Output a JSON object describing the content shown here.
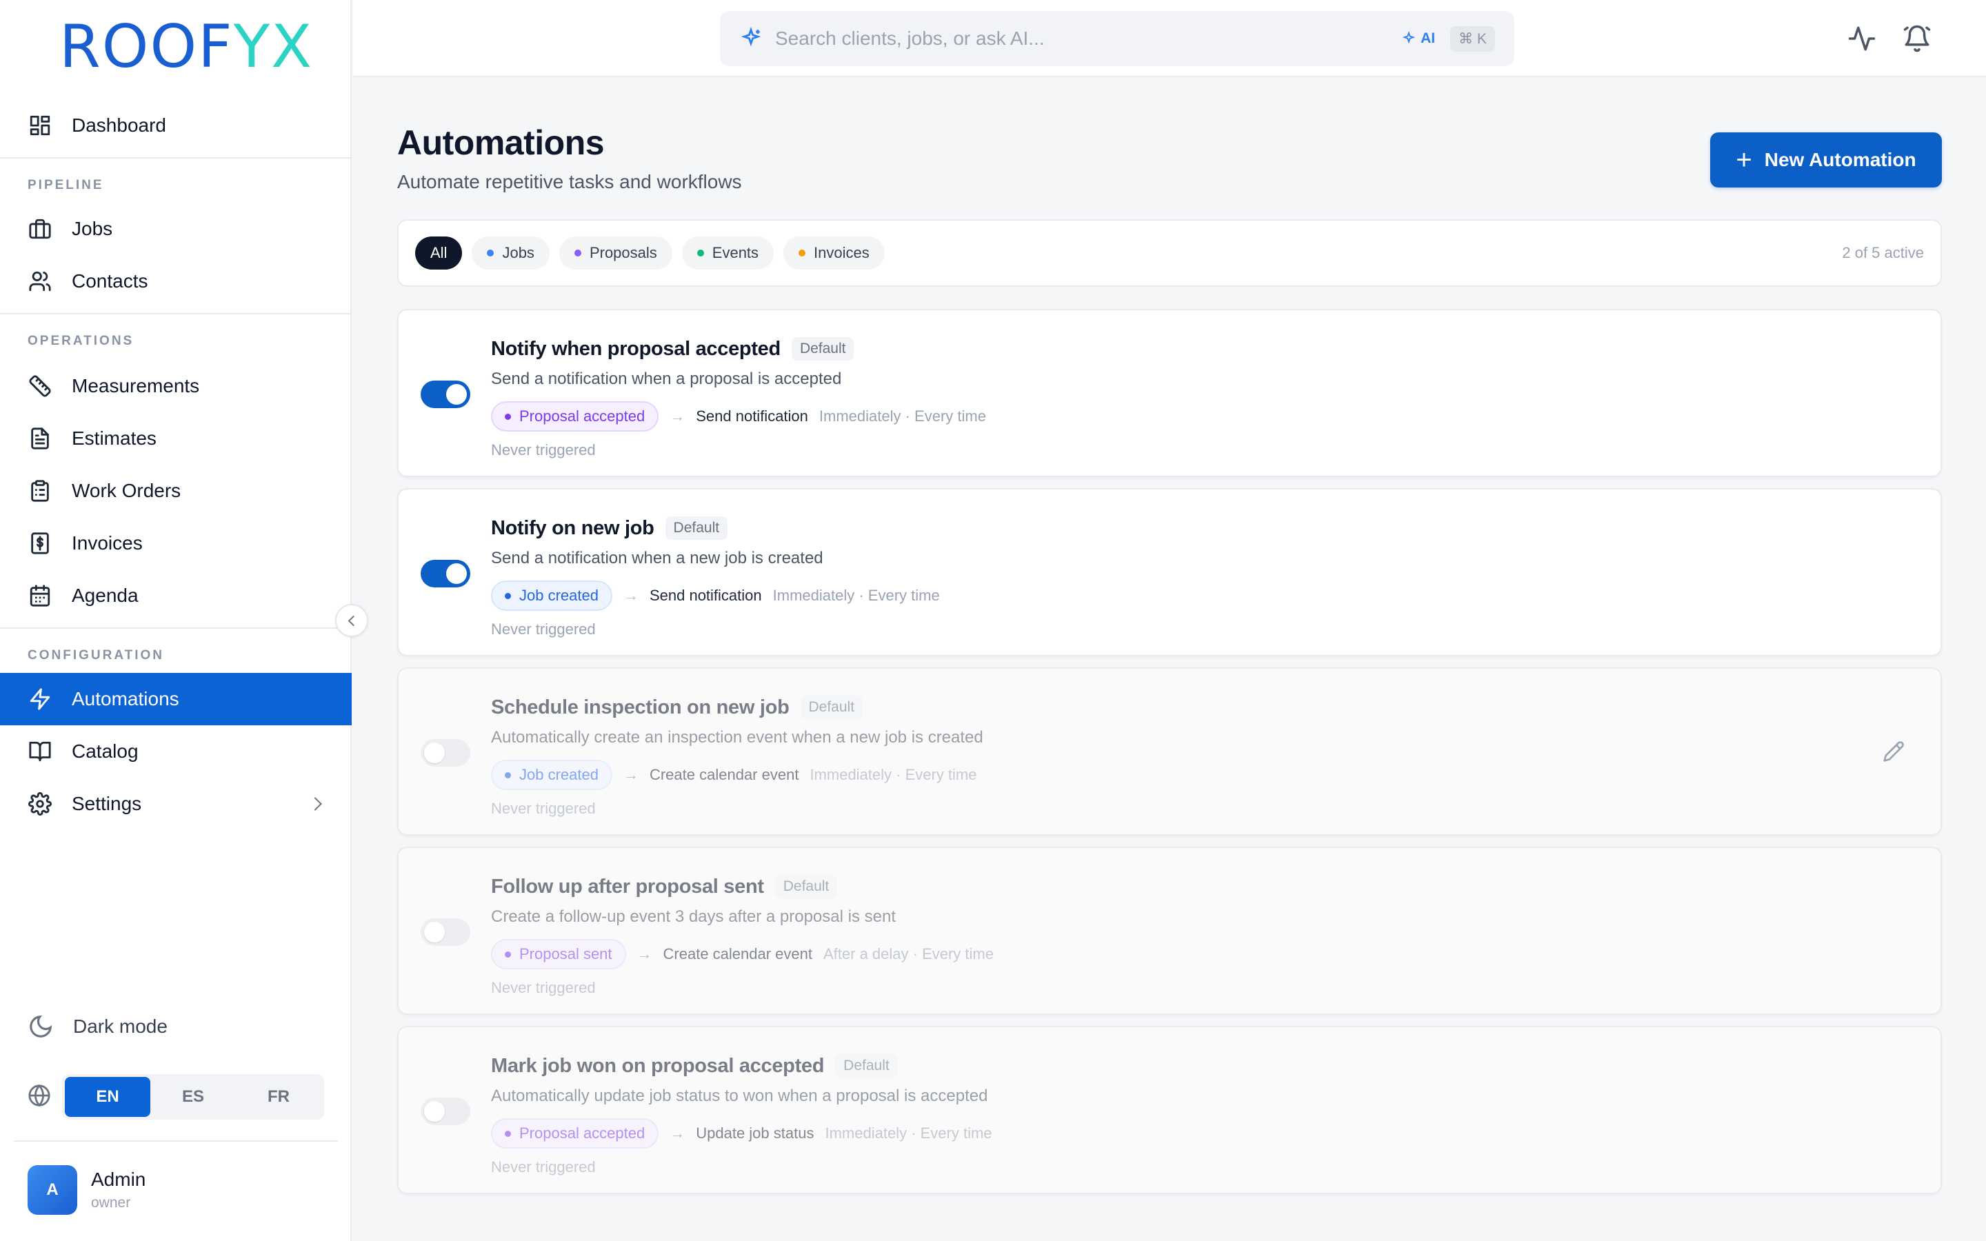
{
  "brand": {
    "logo_part1": "ROOF",
    "logo_part2": "YX"
  },
  "sidebar": {
    "dashboard": "Dashboard",
    "sections": {
      "pipeline": "PIPELINE",
      "operations": "OPERATIONS",
      "configuration": "CONFIGURATION"
    },
    "items": {
      "jobs": "Jobs",
      "contacts": "Contacts",
      "measurements": "Measurements",
      "estimates": "Estimates",
      "work_orders": "Work Orders",
      "invoices": "Invoices",
      "agenda": "Agenda",
      "automations": "Automations",
      "catalog": "Catalog",
      "settings": "Settings"
    },
    "dark_mode": "Dark mode",
    "languages": [
      "EN",
      "ES",
      "FR"
    ],
    "active_language": "EN",
    "user": {
      "initial": "A",
      "name": "Admin",
      "role": "owner"
    }
  },
  "topbar": {
    "search_placeholder": "Search clients, jobs, or ask AI...",
    "ai_label": "AI",
    "shortcut": "⌘ K"
  },
  "page": {
    "title": "Automations",
    "subtitle": "Automate repetitive tasks and workflows",
    "new_button": "New Automation"
  },
  "filters": {
    "chips": [
      {
        "label": "All",
        "active": true,
        "color": ""
      },
      {
        "label": "Jobs",
        "active": false,
        "color": "#3b82f6"
      },
      {
        "label": "Proposals",
        "active": false,
        "color": "#8b5cf6"
      },
      {
        "label": "Events",
        "active": false,
        "color": "#10b981"
      },
      {
        "label": "Invoices",
        "active": false,
        "color": "#f59e0b"
      }
    ],
    "count_text": "2 of 5 active"
  },
  "automations": [
    {
      "title": "Notify when proposal accepted",
      "badge": "Default",
      "description": "Send a notification when a proposal is accepted",
      "trigger": "Proposal accepted",
      "trigger_color": "purple",
      "action": "Send notification",
      "timing": "Immediately · Every time",
      "status": "Never triggered",
      "enabled": true
    },
    {
      "title": "Notify on new job",
      "badge": "Default",
      "description": "Send a notification when a new job is created",
      "trigger": "Job created",
      "trigger_color": "blue",
      "action": "Send notification",
      "timing": "Immediately · Every time",
      "status": "Never triggered",
      "enabled": true
    },
    {
      "title": "Schedule inspection on new job",
      "badge": "Default",
      "description": "Automatically create an inspection event when a new job is created",
      "trigger": "Job created",
      "trigger_color": "blue",
      "action": "Create calendar event",
      "timing": "Immediately · Every time",
      "status": "Never triggered",
      "enabled": false
    },
    {
      "title": "Follow up after proposal sent",
      "badge": "Default",
      "description": "Create a follow-up event 3 days after a proposal is sent",
      "trigger": "Proposal sent",
      "trigger_color": "purple",
      "action": "Create calendar event",
      "timing": "After a delay · Every time",
      "status": "Never triggered",
      "enabled": false
    },
    {
      "title": "Mark job won on proposal accepted",
      "badge": "Default",
      "description": "Automatically update job status to won when a proposal is accepted",
      "trigger": "Proposal accepted",
      "trigger_color": "purple",
      "action": "Update job status",
      "timing": "Immediately · Every time",
      "status": "Never triggered",
      "enabled": false
    }
  ]
}
